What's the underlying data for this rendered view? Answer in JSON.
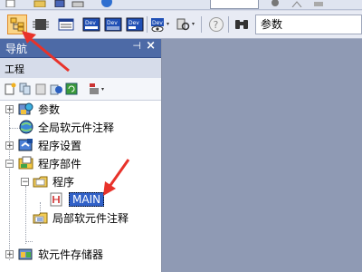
{
  "toolbar": {
    "search_value": "参数"
  },
  "navigation": {
    "title": "导航",
    "pin_glyph": "⊣",
    "close_glyph": "×"
  },
  "project": {
    "label": "工程",
    "tree": [
      {
        "label": "参数",
        "icon": "parameter-icon",
        "expander": "+"
      },
      {
        "label": "全局软元件注释",
        "icon": "global-comment-icon"
      },
      {
        "label": "程序设置",
        "icon": "program-setting-icon",
        "expander": "+"
      },
      {
        "label": "程序部件",
        "icon": "program-parts-icon",
        "expander": "−"
      },
      {
        "label": "程序",
        "icon": "program-folder-icon",
        "expander": "−"
      },
      {
        "label": "MAIN",
        "icon": "ladder-program-icon",
        "selected": true
      },
      {
        "label": "局部软元件注释",
        "icon": "local-comment-icon"
      },
      {
        "label": "软元件存储器",
        "icon": "device-memory-icon",
        "expander": "+"
      }
    ]
  },
  "colors": {
    "nav_header": "#4d6aa6",
    "selection": "#3161c8",
    "mdi_background": "#8f9ab4",
    "annotation_arrow": "#e8322a"
  }
}
